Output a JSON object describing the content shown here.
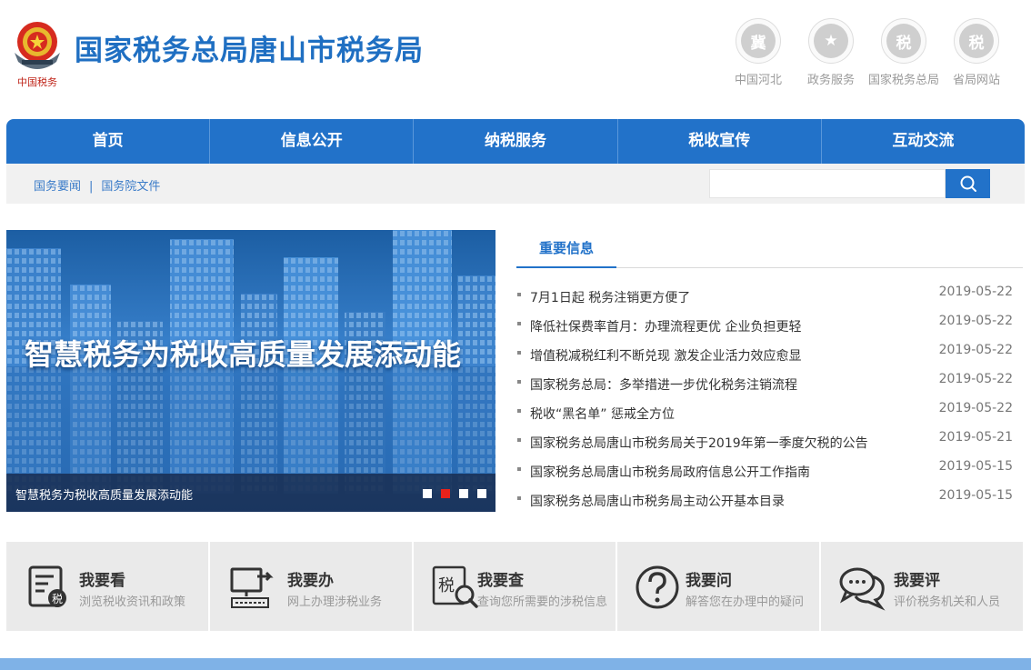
{
  "header": {
    "title": "国家税务总局唐山市税务局",
    "emblem_text": "中国税务",
    "top_links": [
      {
        "label": "中国河北",
        "glyph": "冀",
        "icon": "hebei-icon"
      },
      {
        "label": "政务服务",
        "glyph": "★",
        "icon": "star-badge-icon"
      },
      {
        "label": "国家税务总局",
        "glyph": "税",
        "icon": "tax-bureau-icon"
      },
      {
        "label": "省局网站",
        "glyph": "税",
        "icon": "tax-bureau-icon"
      }
    ]
  },
  "nav": {
    "items": [
      "首页",
      "信息公开",
      "纳税服务",
      "税收宣传",
      "互动交流"
    ]
  },
  "subbar": {
    "links": [
      "国务要闻",
      "国务院文件"
    ],
    "separator": "|",
    "search_placeholder": ""
  },
  "banner": {
    "headline": "智慧税务为税收高质量发展添动能",
    "caption": "智慧税务为税收高质量发展添动能",
    "slides": 4,
    "active_slide": 2
  },
  "news": {
    "tab": "重要信息",
    "items": [
      {
        "title": "7月1日起 税务注销更方便了",
        "date": "2019-05-22"
      },
      {
        "title": "降低社保费率首月：办理流程更优 企业负担更轻",
        "date": "2019-05-22"
      },
      {
        "title": "增值税减税红利不断兑现 激发企业活力效应愈显",
        "date": "2019-05-22"
      },
      {
        "title": "国家税务总局：多举措进一步优化税务注销流程",
        "date": "2019-05-22"
      },
      {
        "title": "税收“黑名单” 惩戒全方位",
        "date": "2019-05-22"
      },
      {
        "title": "国家税务总局唐山市税务局关于2019年第一季度欠税的公告",
        "date": "2019-05-21"
      },
      {
        "title": "国家税务总局唐山市税务局政府信息公开工作指南",
        "date": "2019-05-15"
      },
      {
        "title": "国家税务总局唐山市税务局主动公开基本目录",
        "date": "2019-05-15"
      }
    ]
  },
  "services": [
    {
      "title": "我要看",
      "desc": "浏览税收资讯和政策",
      "icon": "document-tax-icon"
    },
    {
      "title": "我要办",
      "desc": "网上办理涉税业务",
      "icon": "computer-icon"
    },
    {
      "title": "我要查",
      "desc": "查询您所需要的涉税信息",
      "icon": "tax-search-icon"
    },
    {
      "title": "我要问",
      "desc": "解答您在办理中的疑问",
      "icon": "question-icon"
    },
    {
      "title": "我要评",
      "desc": "评价税务机关和人员",
      "icon": "chat-bubbles-icon"
    }
  ],
  "colors": {
    "brand": "#2272c9",
    "title": "#1f6fc2",
    "active_dot": "#e8221b",
    "footer": "#7fb2e7"
  }
}
